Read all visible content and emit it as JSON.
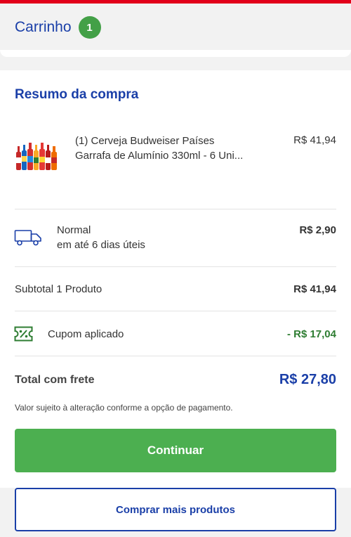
{
  "colors": {
    "brand_red": "#e2001a",
    "brand_blue": "#1a3fa8",
    "accent_green": "#43a047",
    "button_green": "#4caf50",
    "discount_green": "#2e7d32"
  },
  "header": {
    "title": "Carrinho",
    "cart_count": "1"
  },
  "summary": {
    "title": "Resumo da compra",
    "product": {
      "icon": "beer-bottles-image",
      "name": "(1) Cerveja Budweiser Países Garrafa de Alumínio 330ml - 6 Uni...",
      "price": "R$ 41,94"
    },
    "shipping": {
      "icon": "truck-icon",
      "name": "Normal",
      "time": "em até 6 dias úteis",
      "price": "R$ 2,90"
    },
    "subtotal": {
      "label": "Subtotal 1 Produto",
      "value": "R$ 41,94"
    },
    "coupon": {
      "icon": "coupon-percent-icon",
      "label": "Cupom aplicado",
      "value": "- R$ 17,04"
    },
    "total": {
      "label": "Total com frete",
      "value": "R$ 27,80"
    },
    "note": "Valor sujeito à alteração conforme a opção de pagamento."
  },
  "actions": {
    "continue_label": "Continuar",
    "more_label": "Comprar mais produtos"
  }
}
